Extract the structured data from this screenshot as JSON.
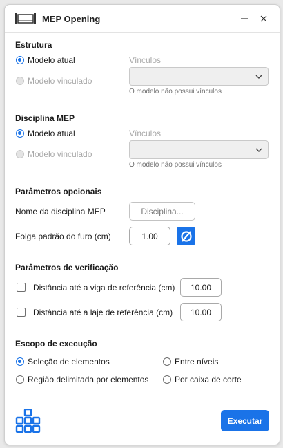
{
  "window": {
    "title": "MEP Opening"
  },
  "estrutura": {
    "title": "Estrutura",
    "option_current": "Modelo atual",
    "option_linked": "Modelo vinculado",
    "links_label": "Vínculos",
    "links_hint": "O modelo não possui vínculos"
  },
  "disciplina": {
    "title": "Disciplina MEP",
    "option_current": "Modelo atual",
    "option_linked": "Modelo vinculado",
    "links_label": "Vínculos",
    "links_hint": "O modelo não possui vínculos"
  },
  "opcionais": {
    "title": "Parâmetros opcionais",
    "discipline_name_label": "Nome da disciplina MEP",
    "discipline_placeholder": "Disciplina...",
    "clearance_label": "Folga padrão do furo (cm)",
    "clearance_value": "1.00"
  },
  "verificacao": {
    "title": "Parâmetros de verificação",
    "beam_label": "Distância até a viga de referência (cm)",
    "beam_value": "10.00",
    "slab_label": "Distância até a laje de referência (cm)",
    "slab_value": "10.00"
  },
  "escopo": {
    "title": "Escopo de execução",
    "opt_selection": "Seleção de elementos",
    "opt_levels": "Entre níveis",
    "opt_region": "Região delimitada por elementos",
    "opt_section_box": "Por caixa de corte"
  },
  "footer": {
    "execute_label": "Executar"
  },
  "colors": {
    "accent": "#1a73e8"
  },
  "icons": [
    "app-icon",
    "minimize-icon",
    "close-icon",
    "chevron-down-icon",
    "diameter-icon",
    "brand-logo-icon"
  ]
}
